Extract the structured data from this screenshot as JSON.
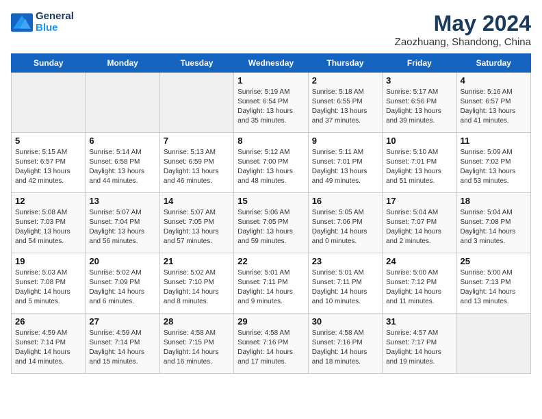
{
  "header": {
    "logo_line1": "General",
    "logo_line2": "Blue",
    "month": "May 2024",
    "location": "Zaozhuang, Shandong, China"
  },
  "weekdays": [
    "Sunday",
    "Monday",
    "Tuesday",
    "Wednesday",
    "Thursday",
    "Friday",
    "Saturday"
  ],
  "weeks": [
    [
      {
        "day": "",
        "info": ""
      },
      {
        "day": "",
        "info": ""
      },
      {
        "day": "",
        "info": ""
      },
      {
        "day": "1",
        "info": "Sunrise: 5:19 AM\nSunset: 6:54 PM\nDaylight: 13 hours\nand 35 minutes."
      },
      {
        "day": "2",
        "info": "Sunrise: 5:18 AM\nSunset: 6:55 PM\nDaylight: 13 hours\nand 37 minutes."
      },
      {
        "day": "3",
        "info": "Sunrise: 5:17 AM\nSunset: 6:56 PM\nDaylight: 13 hours\nand 39 minutes."
      },
      {
        "day": "4",
        "info": "Sunrise: 5:16 AM\nSunset: 6:57 PM\nDaylight: 13 hours\nand 41 minutes."
      }
    ],
    [
      {
        "day": "5",
        "info": "Sunrise: 5:15 AM\nSunset: 6:57 PM\nDaylight: 13 hours\nand 42 minutes."
      },
      {
        "day": "6",
        "info": "Sunrise: 5:14 AM\nSunset: 6:58 PM\nDaylight: 13 hours\nand 44 minutes."
      },
      {
        "day": "7",
        "info": "Sunrise: 5:13 AM\nSunset: 6:59 PM\nDaylight: 13 hours\nand 46 minutes."
      },
      {
        "day": "8",
        "info": "Sunrise: 5:12 AM\nSunset: 7:00 PM\nDaylight: 13 hours\nand 48 minutes."
      },
      {
        "day": "9",
        "info": "Sunrise: 5:11 AM\nSunset: 7:01 PM\nDaylight: 13 hours\nand 49 minutes."
      },
      {
        "day": "10",
        "info": "Sunrise: 5:10 AM\nSunset: 7:01 PM\nDaylight: 13 hours\nand 51 minutes."
      },
      {
        "day": "11",
        "info": "Sunrise: 5:09 AM\nSunset: 7:02 PM\nDaylight: 13 hours\nand 53 minutes."
      }
    ],
    [
      {
        "day": "12",
        "info": "Sunrise: 5:08 AM\nSunset: 7:03 PM\nDaylight: 13 hours\nand 54 minutes."
      },
      {
        "day": "13",
        "info": "Sunrise: 5:07 AM\nSunset: 7:04 PM\nDaylight: 13 hours\nand 56 minutes."
      },
      {
        "day": "14",
        "info": "Sunrise: 5:07 AM\nSunset: 7:05 PM\nDaylight: 13 hours\nand 57 minutes."
      },
      {
        "day": "15",
        "info": "Sunrise: 5:06 AM\nSunset: 7:05 PM\nDaylight: 13 hours\nand 59 minutes."
      },
      {
        "day": "16",
        "info": "Sunrise: 5:05 AM\nSunset: 7:06 PM\nDaylight: 14 hours\nand 0 minutes."
      },
      {
        "day": "17",
        "info": "Sunrise: 5:04 AM\nSunset: 7:07 PM\nDaylight: 14 hours\nand 2 minutes."
      },
      {
        "day": "18",
        "info": "Sunrise: 5:04 AM\nSunset: 7:08 PM\nDaylight: 14 hours\nand 3 minutes."
      }
    ],
    [
      {
        "day": "19",
        "info": "Sunrise: 5:03 AM\nSunset: 7:08 PM\nDaylight: 14 hours\nand 5 minutes."
      },
      {
        "day": "20",
        "info": "Sunrise: 5:02 AM\nSunset: 7:09 PM\nDaylight: 14 hours\nand 6 minutes."
      },
      {
        "day": "21",
        "info": "Sunrise: 5:02 AM\nSunset: 7:10 PM\nDaylight: 14 hours\nand 8 minutes."
      },
      {
        "day": "22",
        "info": "Sunrise: 5:01 AM\nSunset: 7:11 PM\nDaylight: 14 hours\nand 9 minutes."
      },
      {
        "day": "23",
        "info": "Sunrise: 5:01 AM\nSunset: 7:11 PM\nDaylight: 14 hours\nand 10 minutes."
      },
      {
        "day": "24",
        "info": "Sunrise: 5:00 AM\nSunset: 7:12 PM\nDaylight: 14 hours\nand 11 minutes."
      },
      {
        "day": "25",
        "info": "Sunrise: 5:00 AM\nSunset: 7:13 PM\nDaylight: 14 hours\nand 13 minutes."
      }
    ],
    [
      {
        "day": "26",
        "info": "Sunrise: 4:59 AM\nSunset: 7:14 PM\nDaylight: 14 hours\nand 14 minutes."
      },
      {
        "day": "27",
        "info": "Sunrise: 4:59 AM\nSunset: 7:14 PM\nDaylight: 14 hours\nand 15 minutes."
      },
      {
        "day": "28",
        "info": "Sunrise: 4:58 AM\nSunset: 7:15 PM\nDaylight: 14 hours\nand 16 minutes."
      },
      {
        "day": "29",
        "info": "Sunrise: 4:58 AM\nSunset: 7:16 PM\nDaylight: 14 hours\nand 17 minutes."
      },
      {
        "day": "30",
        "info": "Sunrise: 4:58 AM\nSunset: 7:16 PM\nDaylight: 14 hours\nand 18 minutes."
      },
      {
        "day": "31",
        "info": "Sunrise: 4:57 AM\nSunset: 7:17 PM\nDaylight: 14 hours\nand 19 minutes."
      },
      {
        "day": "",
        "info": ""
      }
    ]
  ]
}
